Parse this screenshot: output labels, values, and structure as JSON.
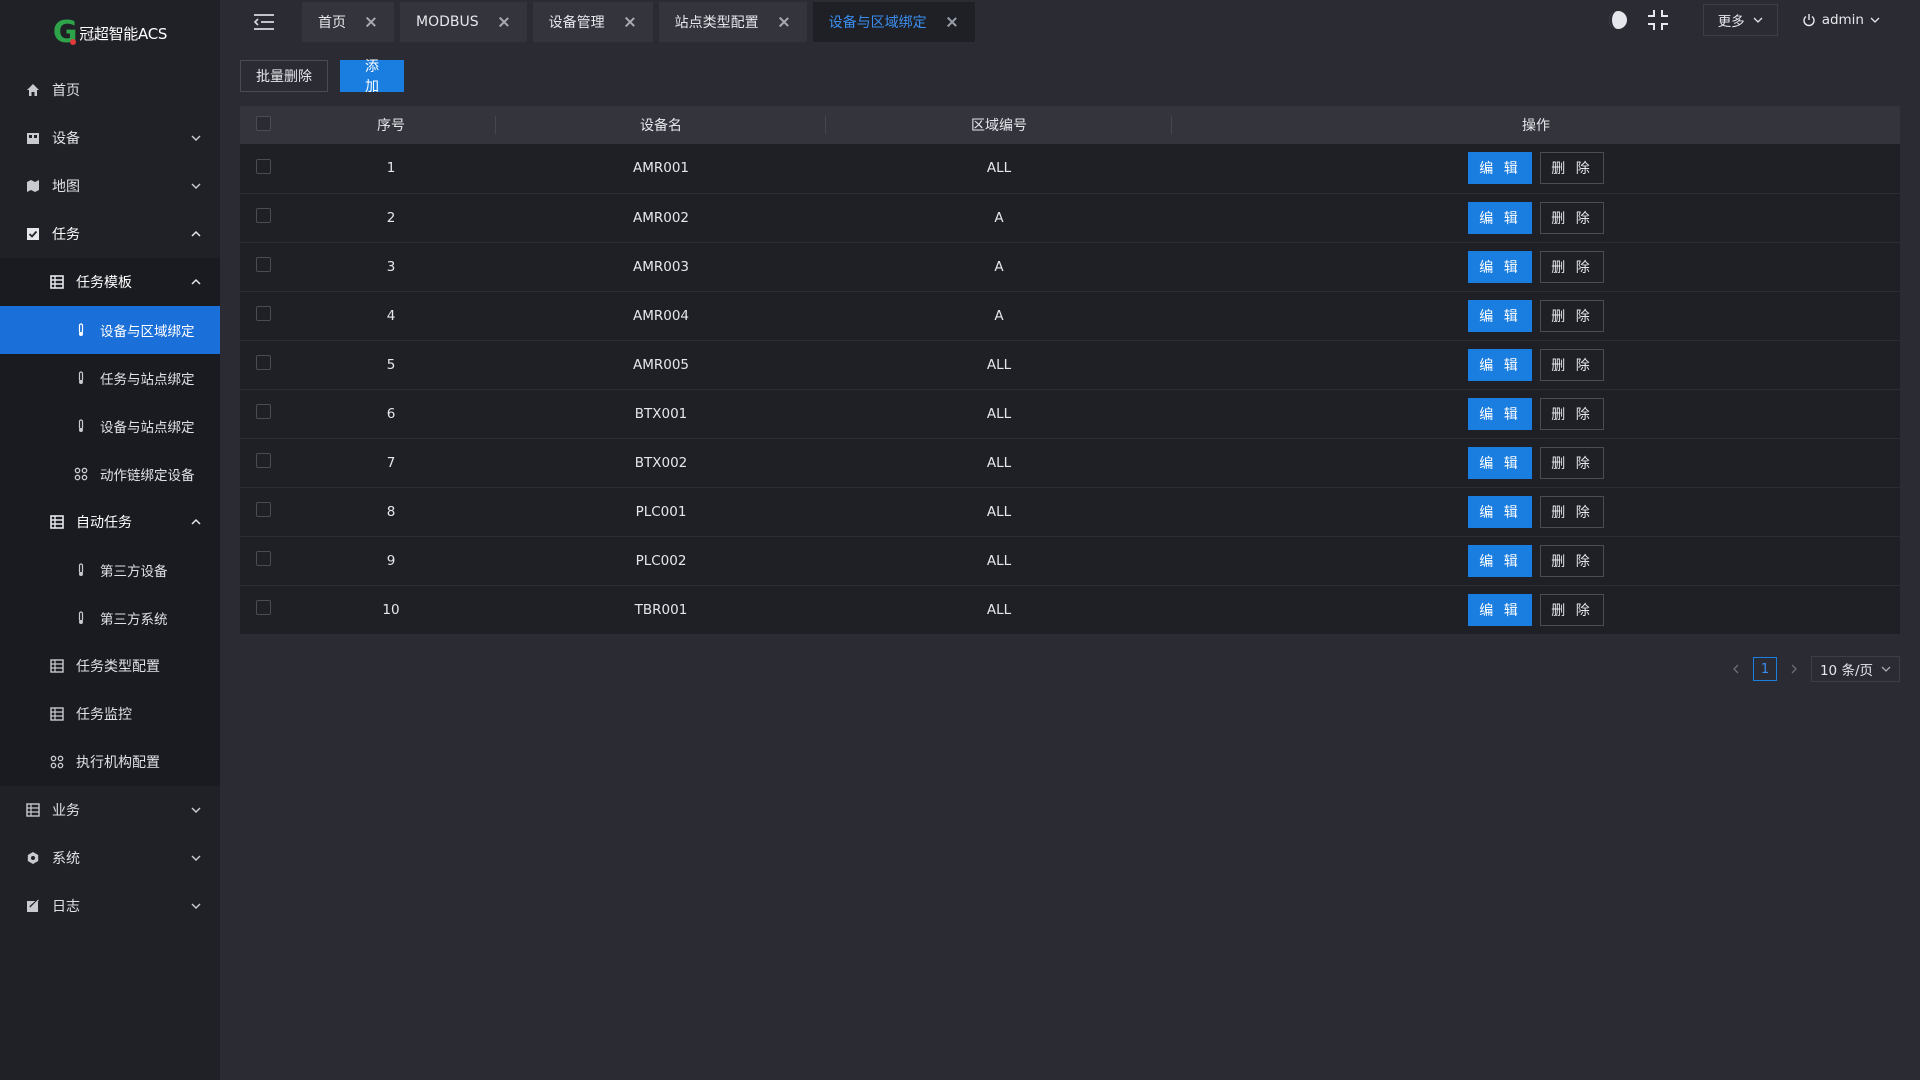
{
  "app": {
    "logo_letter": "G",
    "logo_text": "冠超智能ACS"
  },
  "sidebar": {
    "items": [
      {
        "label": "首页",
        "icon": "home-icon"
      },
      {
        "label": "设备",
        "icon": "device-icon"
      },
      {
        "label": "地图",
        "icon": "map-icon"
      },
      {
        "label": "任务",
        "icon": "task-icon"
      },
      {
        "label": "任务模板",
        "icon": "grid-icon"
      },
      {
        "label": "设备与区域绑定",
        "icon": "thermometer-icon"
      },
      {
        "label": "任务与站点绑定",
        "icon": "thermometer-icon"
      },
      {
        "label": "设备与站点绑定",
        "icon": "thermometer-icon"
      },
      {
        "label": "动作链绑定设备",
        "icon": "command-icon"
      },
      {
        "label": "自动任务",
        "icon": "grid-icon"
      },
      {
        "label": "第三方设备",
        "icon": "thermometer-icon"
      },
      {
        "label": "第三方系统",
        "icon": "thermometer-icon"
      },
      {
        "label": "任务类型配置",
        "icon": "grid-icon"
      },
      {
        "label": "任务监控",
        "icon": "grid-icon"
      },
      {
        "label": "执行机构配置",
        "icon": "command-icon"
      },
      {
        "label": "业务",
        "icon": "grid-icon"
      },
      {
        "label": "系统",
        "icon": "gear-icon"
      },
      {
        "label": "日志",
        "icon": "log-icon"
      }
    ]
  },
  "tabs": [
    {
      "label": "首页"
    },
    {
      "label": "MODBUS"
    },
    {
      "label": "设备管理"
    },
    {
      "label": "站点类型配置"
    },
    {
      "label": "设备与区域绑定"
    }
  ],
  "header": {
    "more_label": "更多",
    "user_label": "admin"
  },
  "toolbar": {
    "batch_delete_label": "批量删除",
    "add_label": "添 加"
  },
  "table": {
    "columns": [
      "序号",
      "设备名",
      "区域编号",
      "操作"
    ],
    "edit_label": "编 辑",
    "delete_label": "删 除",
    "rows": [
      {
        "idx": "1",
        "name": "AMR001",
        "area": "ALL"
      },
      {
        "idx": "2",
        "name": "AMR002",
        "area": "A"
      },
      {
        "idx": "3",
        "name": "AMR003",
        "area": "A"
      },
      {
        "idx": "4",
        "name": "AMR004",
        "area": "A"
      },
      {
        "idx": "5",
        "name": "AMR005",
        "area": "ALL"
      },
      {
        "idx": "6",
        "name": "BTX001",
        "area": "ALL"
      },
      {
        "idx": "7",
        "name": "BTX002",
        "area": "ALL"
      },
      {
        "idx": "8",
        "name": "PLC001",
        "area": "ALL"
      },
      {
        "idx": "9",
        "name": "PLC002",
        "area": "ALL"
      },
      {
        "idx": "10",
        "name": "TBR001",
        "area": "ALL"
      }
    ]
  },
  "pagination": {
    "current_page": "1",
    "page_size_label": "10 条/页"
  },
  "colors": {
    "accent": "#1a7de0",
    "sidebar_bg": "#202127",
    "content_bg": "#2a2b33",
    "logo_green": "#2fa34a"
  }
}
